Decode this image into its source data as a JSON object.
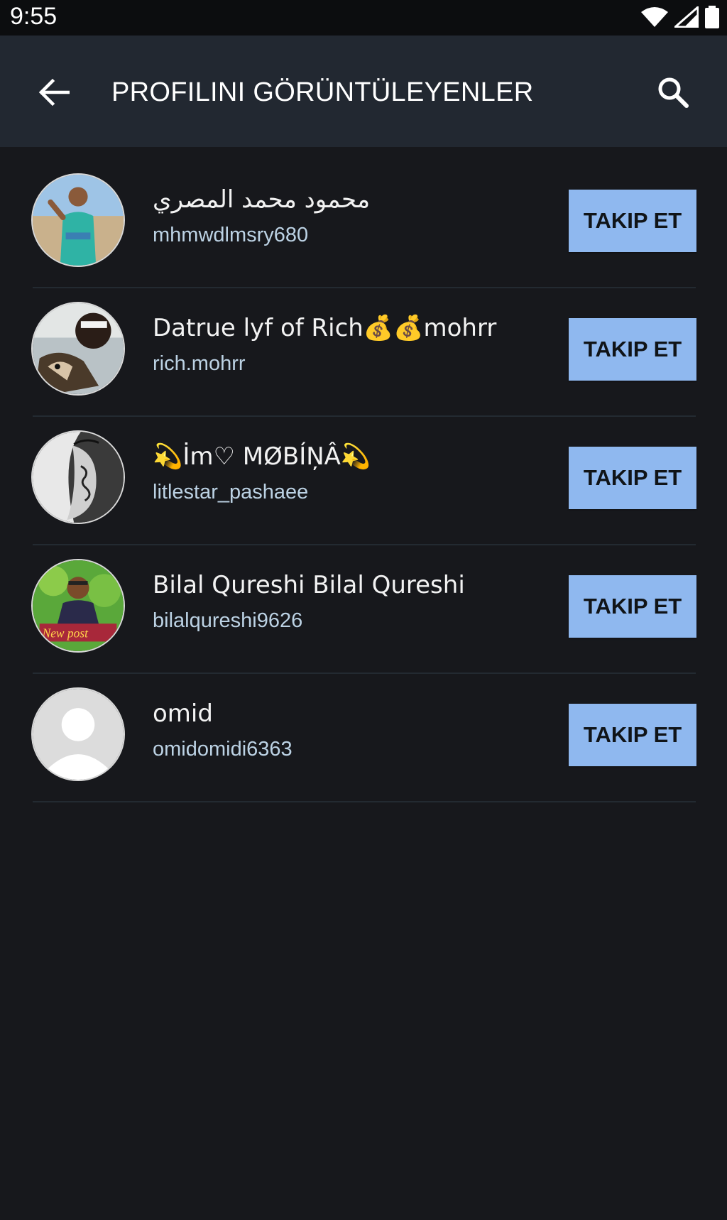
{
  "status_bar": {
    "time": "9:55",
    "icons": [
      "wifi-icon",
      "signal-icon",
      "battery-icon"
    ]
  },
  "app_bar": {
    "back_icon": "arrow-left-icon",
    "title": "PROFILINI GÖRÜNTÜLEYENLER",
    "search_icon": "search-icon"
  },
  "colors": {
    "background": "#17181c",
    "app_bar": "#222831",
    "button": "#8fb8ef",
    "username": "#bcd2e4"
  },
  "viewers": [
    {
      "name": "محمود محمد المصري",
      "username": "mhmwdlmsry680",
      "button": "TAKIP ET"
    },
    {
      "name": "Datrue lyf of Rich💰💰mohrr",
      "username": "rich.mohrr",
      "button": "TAKIP ET"
    },
    {
      "name": "💫İm♡ MØBÍŅÂ💫",
      "username": "litlestar_pashaee",
      "button": "TAKIP ET"
    },
    {
      "name": "Bilal Qureshi Bilal Qureshi",
      "username": "bilalqureshi9626",
      "button": "TAKIP ET"
    },
    {
      "name": "omid",
      "username": "omidomidi6363",
      "button": "TAKIP ET"
    }
  ],
  "avatar_overlay_text": "New post"
}
